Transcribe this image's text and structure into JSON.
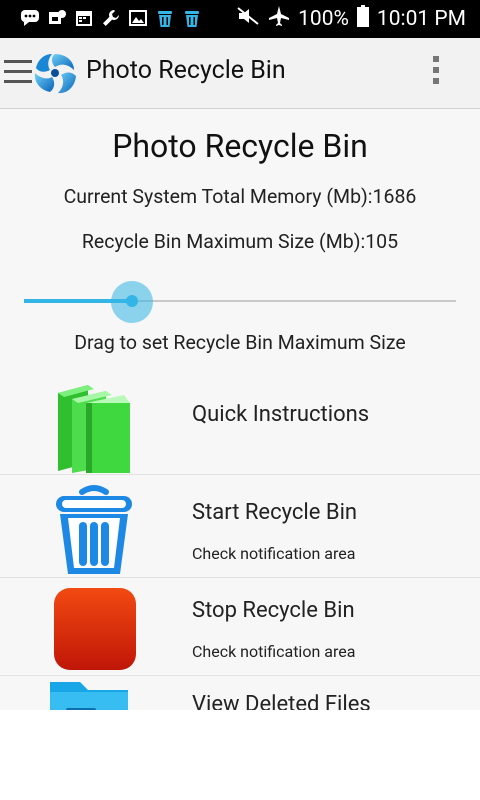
{
  "status_bar": {
    "battery": "100%",
    "time": "10:01 PM"
  },
  "app_bar": {
    "title": "Photo Recycle Bin"
  },
  "main": {
    "heading": "Photo Recycle Bin",
    "total_memory_text": "Current System Total Memory (Mb):1686",
    "max_size_text": "Recycle Bin Maximum Size (Mb):105",
    "slider": {
      "value_fraction": 0.25
    },
    "slider_hint": "Drag to set Recycle Bin Maximum Size"
  },
  "menu": {
    "items": [
      {
        "title": "Quick Instructions",
        "subtitle": ""
      },
      {
        "title": "Start Recycle Bin",
        "subtitle": "Check notification area"
      },
      {
        "title": "Stop Recycle Bin",
        "subtitle": "Check notification area"
      },
      {
        "title": "View Deleted Files",
        "subtitle": ""
      }
    ]
  },
  "colors": {
    "accent": "#33b5e5",
    "book_green": "#3ad33a",
    "trash_blue": "#1e88e5",
    "stop_red": "#d82a10",
    "folder_blue": "#2aa6e8"
  }
}
